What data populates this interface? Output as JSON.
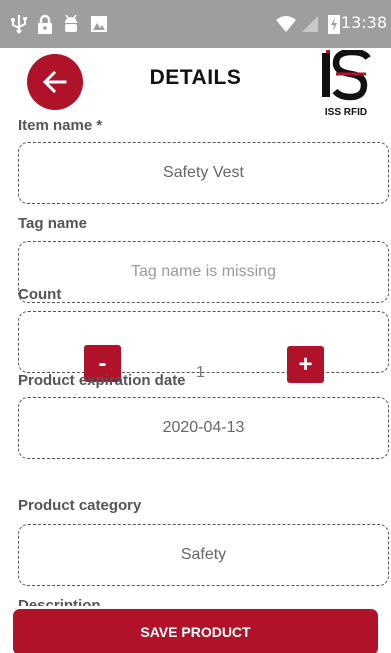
{
  "status_bar": {
    "time": "13:38",
    "icons": [
      "usb-icon",
      "lock-icon",
      "android-debug-icon",
      "image-icon",
      "wifi-icon",
      "no-signal-icon",
      "battery-charging-icon"
    ]
  },
  "header": {
    "title": "DETAILS",
    "logo_text": "ISS RFID"
  },
  "form": {
    "item_name": {
      "label": "Item name *",
      "value": "Safety Vest"
    },
    "tag_name": {
      "label": "Tag name",
      "placeholder": "Tag name is missing"
    },
    "count": {
      "label": "Count",
      "value": "1",
      "minus_label": "-",
      "plus_label": "+"
    },
    "expiration": {
      "label": "Product expiration date",
      "value": "2020-04-13"
    },
    "category": {
      "label": "Product category",
      "value": "Safety"
    },
    "description": {
      "label": "Description"
    }
  },
  "actions": {
    "save_label": "SAVE PRODUCT"
  },
  "colors": {
    "accent": "#b0122a",
    "status_bar": "#9e9e9e"
  }
}
